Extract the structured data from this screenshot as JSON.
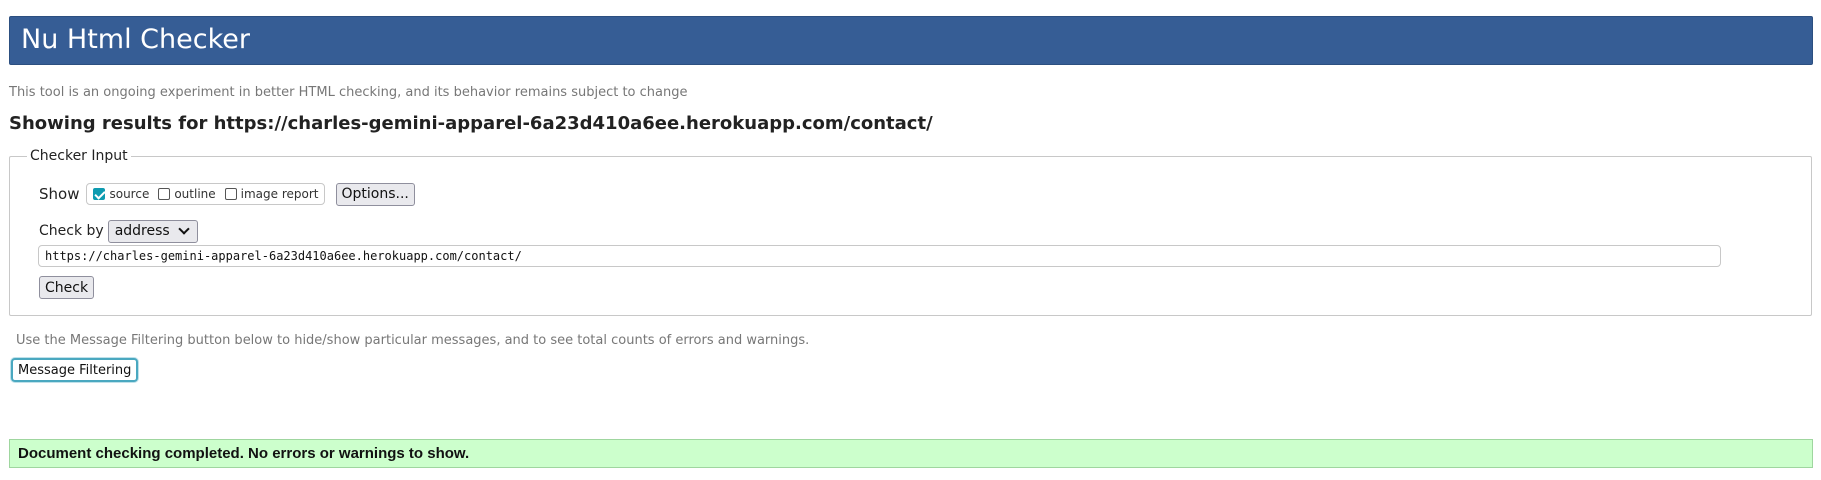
{
  "header": {
    "title": "Nu Html Checker"
  },
  "intro_text": "This tool is an ongoing experiment in better HTML checking, and its behavior remains subject to change",
  "results_heading": "Showing results for https://charles-gemini-apparel-6a23d410a6ee.herokuapp.com/contact/",
  "checker_input": {
    "legend": "Checker Input",
    "show_label": "Show",
    "show_options": [
      {
        "label": "source",
        "checked": true
      },
      {
        "label": "outline",
        "checked": false
      },
      {
        "label": "image report",
        "checked": false
      }
    ],
    "options_button": "Options...",
    "check_by_label": "Check by",
    "check_by_selected": "address",
    "url_value": "https://charles-gemini-apparel-6a23d410a6ee.herokuapp.com/contact/",
    "check_button": "Check"
  },
  "filter_note": "Use the Message Filtering button below to hide/show particular messages, and to see total counts of errors and warnings.",
  "message_filtering_button": "Message Filtering",
  "success_message": "Document checking completed. No errors or warnings to show.",
  "colors": {
    "header_bg": "#365d95",
    "checkbox_accent": "#0e9bb0",
    "success_bg": "#ccffcc"
  }
}
